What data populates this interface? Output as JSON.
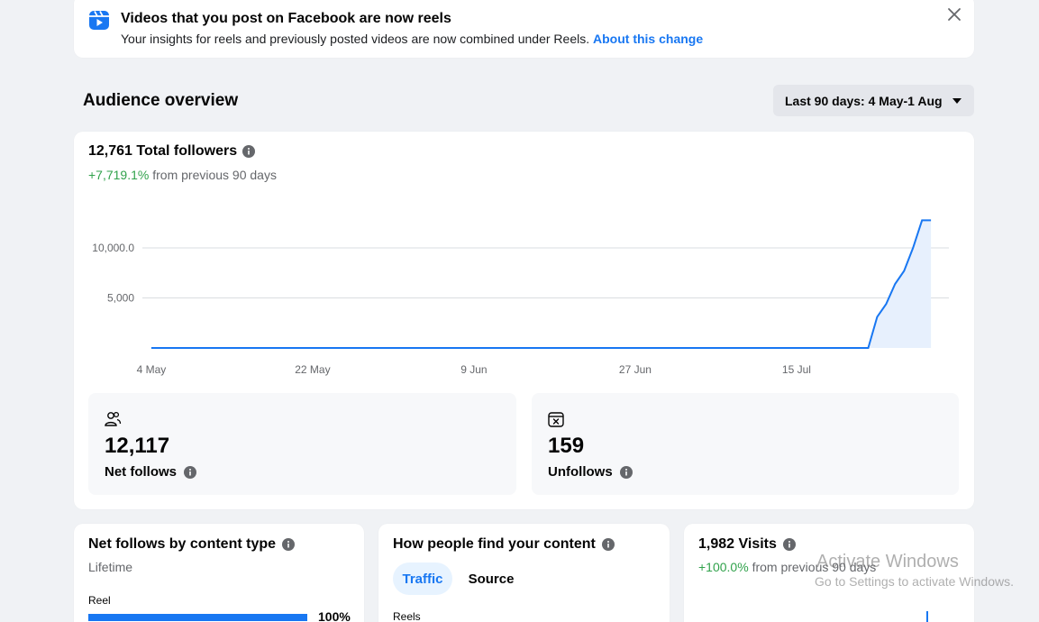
{
  "banner": {
    "title": "Videos that you post on Facebook are now reels",
    "text": "Your insights for reels and previously posted videos are now combined under Reels.",
    "link": "About this change"
  },
  "section": {
    "title": "Audience overview",
    "date_range": "Last 90 days: 4 May-1 Aug"
  },
  "followers": {
    "title": "12,761 Total followers",
    "change": "+7,719.1%",
    "change_suffix": "from previous 90 days"
  },
  "chart_data": {
    "type": "area",
    "title": "",
    "xlabel": "",
    "ylabel": "",
    "y_ticks": [
      "5,000",
      "10,000.0"
    ],
    "y_tick_values": [
      5000,
      10000
    ],
    "x_ticks": [
      "4 May",
      "22 May",
      "9 Jun",
      "27 Jun",
      "15 Jul"
    ],
    "x_tick_values": [
      "2023-05-04",
      "2023-05-22",
      "2023-06-09",
      "2023-06-27",
      "2023-07-15"
    ],
    "ylim": [
      0,
      13000
    ],
    "xlim": [
      "2023-05-03",
      "2023-08-01"
    ],
    "grid": true,
    "series": [
      {
        "color": "#1877f2",
        "x": [
          "2023-05-04",
          "2023-07-23",
          "2023-07-24",
          "2023-07-25",
          "2023-07-26",
          "2023-07-27",
          "2023-07-28",
          "2023-07-29",
          "2023-07-30"
        ],
        "y": [
          0,
          0,
          3100,
          4400,
          6400,
          7700,
          10000,
          12761,
          12761
        ],
        "fill": "#e7f0fd"
      }
    ]
  },
  "net_follows": {
    "value": "12,117",
    "label": "Net follows"
  },
  "unfollows": {
    "value": "159",
    "label": "Unfollows"
  },
  "content_type": {
    "title": "Net follows by content type",
    "sub": "Lifetime",
    "bar_label": "Reel",
    "bar_pct": "100%",
    "bar_value": 100
  },
  "find": {
    "title": "How people find your content",
    "tab_traffic": "Traffic",
    "tab_source": "Source",
    "row_label": "Reels"
  },
  "visits": {
    "title": "1,982 Visits",
    "change": "+100.0%",
    "change_suffix": "from previous 90 days"
  },
  "watermark": {
    "line1": "Activate Windows",
    "line2": "Go to Settings to activate Windows."
  },
  "colors": {
    "accent": "#1877f2",
    "positive": "#31a24c",
    "background": "#f0f2f5"
  },
  "icons": {
    "banner": "reels-icon",
    "close": "close-icon",
    "info": "info-icon",
    "net_follows": "people-icon",
    "unfollows": "unfollow-icon"
  }
}
